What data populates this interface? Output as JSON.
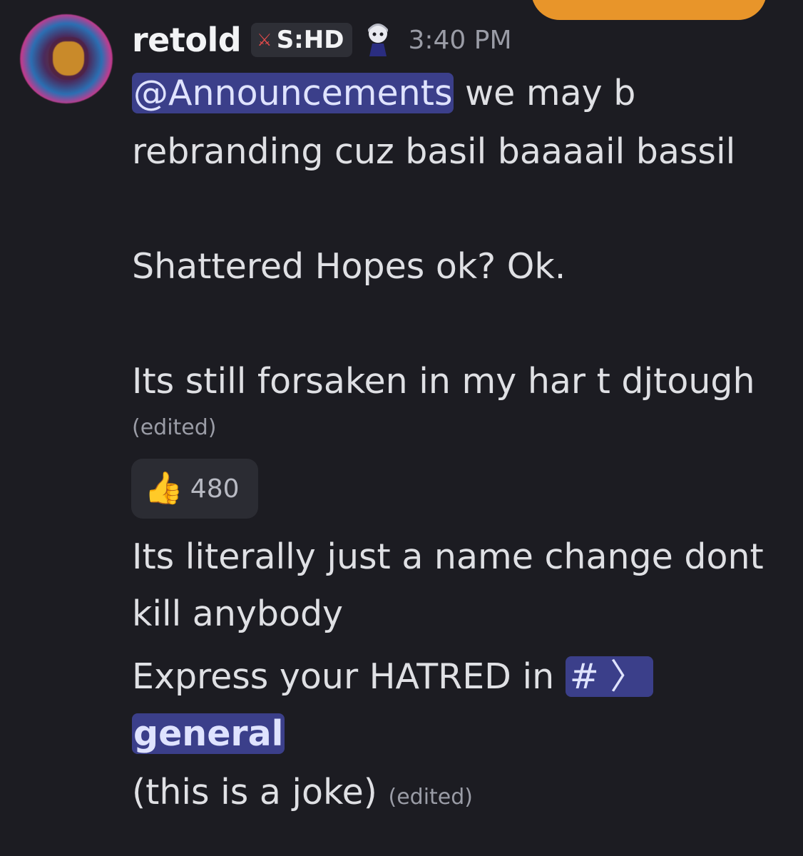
{
  "message": {
    "author": "retold",
    "tag_text": "S:HD",
    "tag_icon": "sword-icon",
    "role_icon": "character-badge-icon",
    "timestamp": "3:40 PM",
    "mention_role": "@Announcements",
    "line1_rest": " we may b",
    "line2": "rebranding cuz basil baaaail bassil",
    "line3": "Shattered Hopes ok? Ok.",
    "line4": "Its still forsaken in my har t djtough",
    "edited_1": "(edited)",
    "reaction_emoji": "👍",
    "reaction_count": "480",
    "followup_line1": "Its literally just a name change dont",
    "followup_line2": "kill anybody",
    "followup_line3_text": "Express your HATRED in ",
    "channel_prefix": "# 〉",
    "channel_name": "general",
    "followup_line5": "(this is a joke)",
    "edited_2": "(edited)"
  },
  "colors": {
    "background": "#1c1c22",
    "mention_bg": "#3b3f8a",
    "top_pill": "#e8952a"
  }
}
